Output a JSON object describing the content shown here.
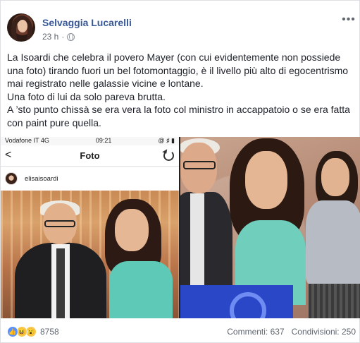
{
  "post": {
    "author": "Selvaggia Lucarelli",
    "time": "23 h",
    "separator": "·",
    "privacy_icon": "globe-icon",
    "more_icon": "more-options-icon",
    "paragraphs": [
      "La Isoardi che celebra il povero Mayer (con cui evidentemente non possiede una foto) tirando fuori un bel fotomontaggio, è il livello più alto di egocentrismo mai registrato nelle galassie vicine e lontane.",
      "Una foto di lui da solo pareva brutta.",
      "A ’sto punto chissà se era vera la foto col ministro in accappatoio o se era fatta con paint pure quella."
    ]
  },
  "phone_screenshot": {
    "carrier": "Vodafone IT  4G",
    "clock": "09:21",
    "status_icons": "@ ♯ ▮",
    "back": "<",
    "title": "Foto",
    "username": "elisaisoardi"
  },
  "footer": {
    "reactions": [
      "like",
      "haha",
      "wow"
    ],
    "reaction_count": "8758",
    "comments": "Commenti: 637",
    "shares": "Condivisioni: 250"
  },
  "colors": {
    "author": "#385898",
    "meta": "#606770",
    "text": "#1d2129",
    "like": "#5890ff"
  }
}
